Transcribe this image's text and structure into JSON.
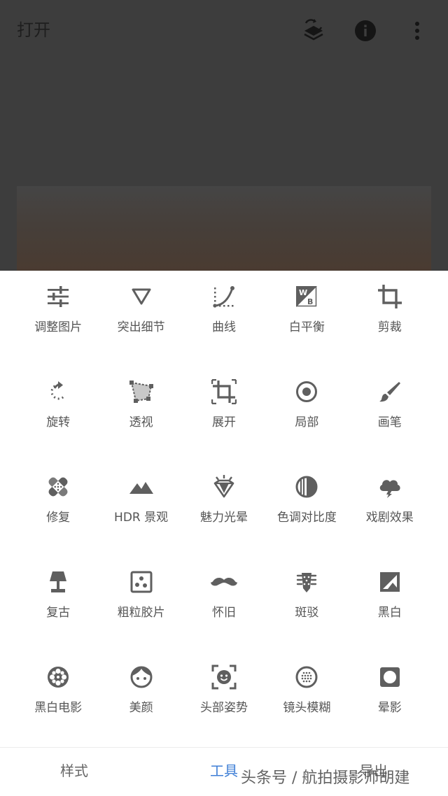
{
  "app_bar": {
    "open_label": "打开",
    "icons": [
      "layers-refresh-icon",
      "info-icon",
      "more-vert-icon"
    ]
  },
  "tools": [
    {
      "label": "调整图片",
      "icon": "tune-icon"
    },
    {
      "label": "突出细节",
      "icon": "details-triangle-icon"
    },
    {
      "label": "曲线",
      "icon": "curves-icon"
    },
    {
      "label": "白平衡",
      "icon": "white-balance-icon"
    },
    {
      "label": "剪裁",
      "icon": "crop-icon"
    },
    {
      "label": "旋转",
      "icon": "rotate-icon"
    },
    {
      "label": "透视",
      "icon": "perspective-icon"
    },
    {
      "label": "展开",
      "icon": "expand-icon"
    },
    {
      "label": "局部",
      "icon": "selective-icon"
    },
    {
      "label": "画笔",
      "icon": "brush-icon"
    },
    {
      "label": "修复",
      "icon": "healing-icon"
    },
    {
      "label": "HDR 景观",
      "icon": "hdr-mountain-icon"
    },
    {
      "label": "魅力光晕",
      "icon": "glamour-glow-icon"
    },
    {
      "label": "色调对比度",
      "icon": "tonal-contrast-icon"
    },
    {
      "label": "戏剧效果",
      "icon": "drama-icon"
    },
    {
      "label": "复古",
      "icon": "vintage-lamp-icon"
    },
    {
      "label": "粗粒胶片",
      "icon": "grainy-film-icon"
    },
    {
      "label": "怀旧",
      "icon": "retrolux-mustache-icon"
    },
    {
      "label": "斑驳",
      "icon": "grunge-guitar-icon"
    },
    {
      "label": "黑白",
      "icon": "black-white-icon"
    },
    {
      "label": "黑白电影",
      "icon": "noir-film-reel-icon"
    },
    {
      "label": "美颜",
      "icon": "face-icon"
    },
    {
      "label": "头部姿势",
      "icon": "head-pose-icon"
    },
    {
      "label": "镜头模糊",
      "icon": "lens-blur-icon"
    },
    {
      "label": "晕影",
      "icon": "vignette-icon"
    }
  ],
  "bottom_nav": {
    "tabs": [
      {
        "label": "样式",
        "active": false
      },
      {
        "label": "工具",
        "active": true
      },
      {
        "label": "导出",
        "active": false
      }
    ]
  },
  "watermark": "头条号 / 航拍摄影师胡建",
  "colors": {
    "icon": "#5f5f5f",
    "label": "#555555",
    "accent": "#3f7fd6",
    "overlay": "#3d3d3d"
  }
}
